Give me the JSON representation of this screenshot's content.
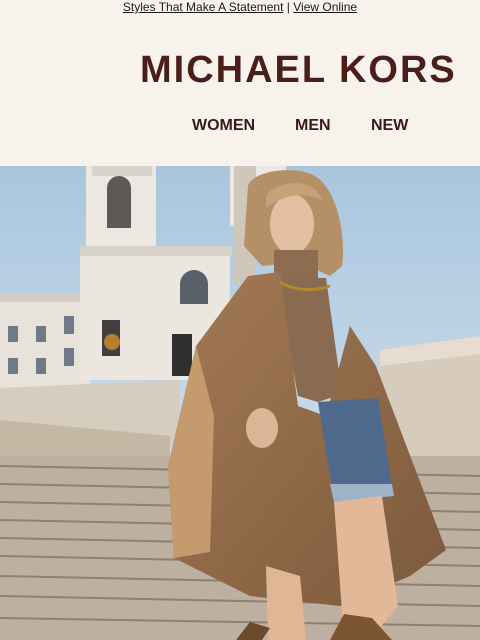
{
  "preheader": {
    "link_statement": "Styles That Make A Statement",
    "separator": "|",
    "link_view_online": "View Online"
  },
  "brand": {
    "logo_text": "MICHAEL KORS",
    "color": "#4a1f1a"
  },
  "nav": {
    "items": [
      "WOMEN",
      "MEN",
      "NEW"
    ]
  },
  "hero": {
    "image_alt_subject": "hero-photo"
  }
}
